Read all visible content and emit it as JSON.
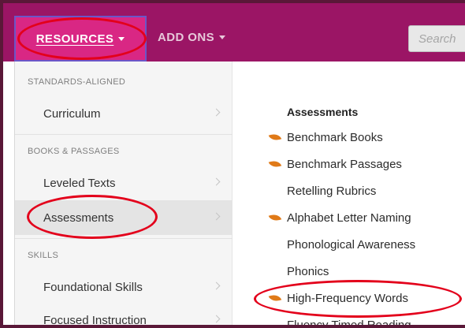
{
  "nav": {
    "resources_label": "RESOURCES",
    "addons_label": "ADD ONS",
    "search_placeholder": "Search"
  },
  "sidebar": {
    "sections": [
      {
        "heading": "STANDARDS-ALIGNED",
        "items": [
          {
            "label": "Curriculum"
          }
        ]
      },
      {
        "heading": "BOOKS & PASSAGES",
        "items": [
          {
            "label": "Leveled Texts"
          },
          {
            "label": "Assessments",
            "active": true
          }
        ]
      },
      {
        "heading": "SKILLS",
        "items": [
          {
            "label": "Foundational Skills"
          },
          {
            "label": "Focused Instruction"
          }
        ]
      }
    ]
  },
  "content": {
    "title": "Assessments",
    "links": [
      {
        "label": "Benchmark Books",
        "icon": "leaf-icon"
      },
      {
        "label": "Benchmark Passages",
        "icon": "leaf-icon"
      },
      {
        "label": "Retelling Rubrics",
        "icon": ""
      },
      {
        "label": "Alphabet Letter Naming",
        "icon": "leaf-icon"
      },
      {
        "label": "Phonological Awareness",
        "icon": ""
      },
      {
        "label": "Phonics",
        "icon": ""
      },
      {
        "label": "High-Frequency Words",
        "icon": "leaf-icon"
      },
      {
        "label": "Fluency Timed Reading",
        "icon": ""
      }
    ]
  },
  "colors": {
    "brand_bar": "#9b1565",
    "active_tab": "#d92784",
    "annotation_red": "#e3001b",
    "leaf_orange": "#e07a18"
  }
}
